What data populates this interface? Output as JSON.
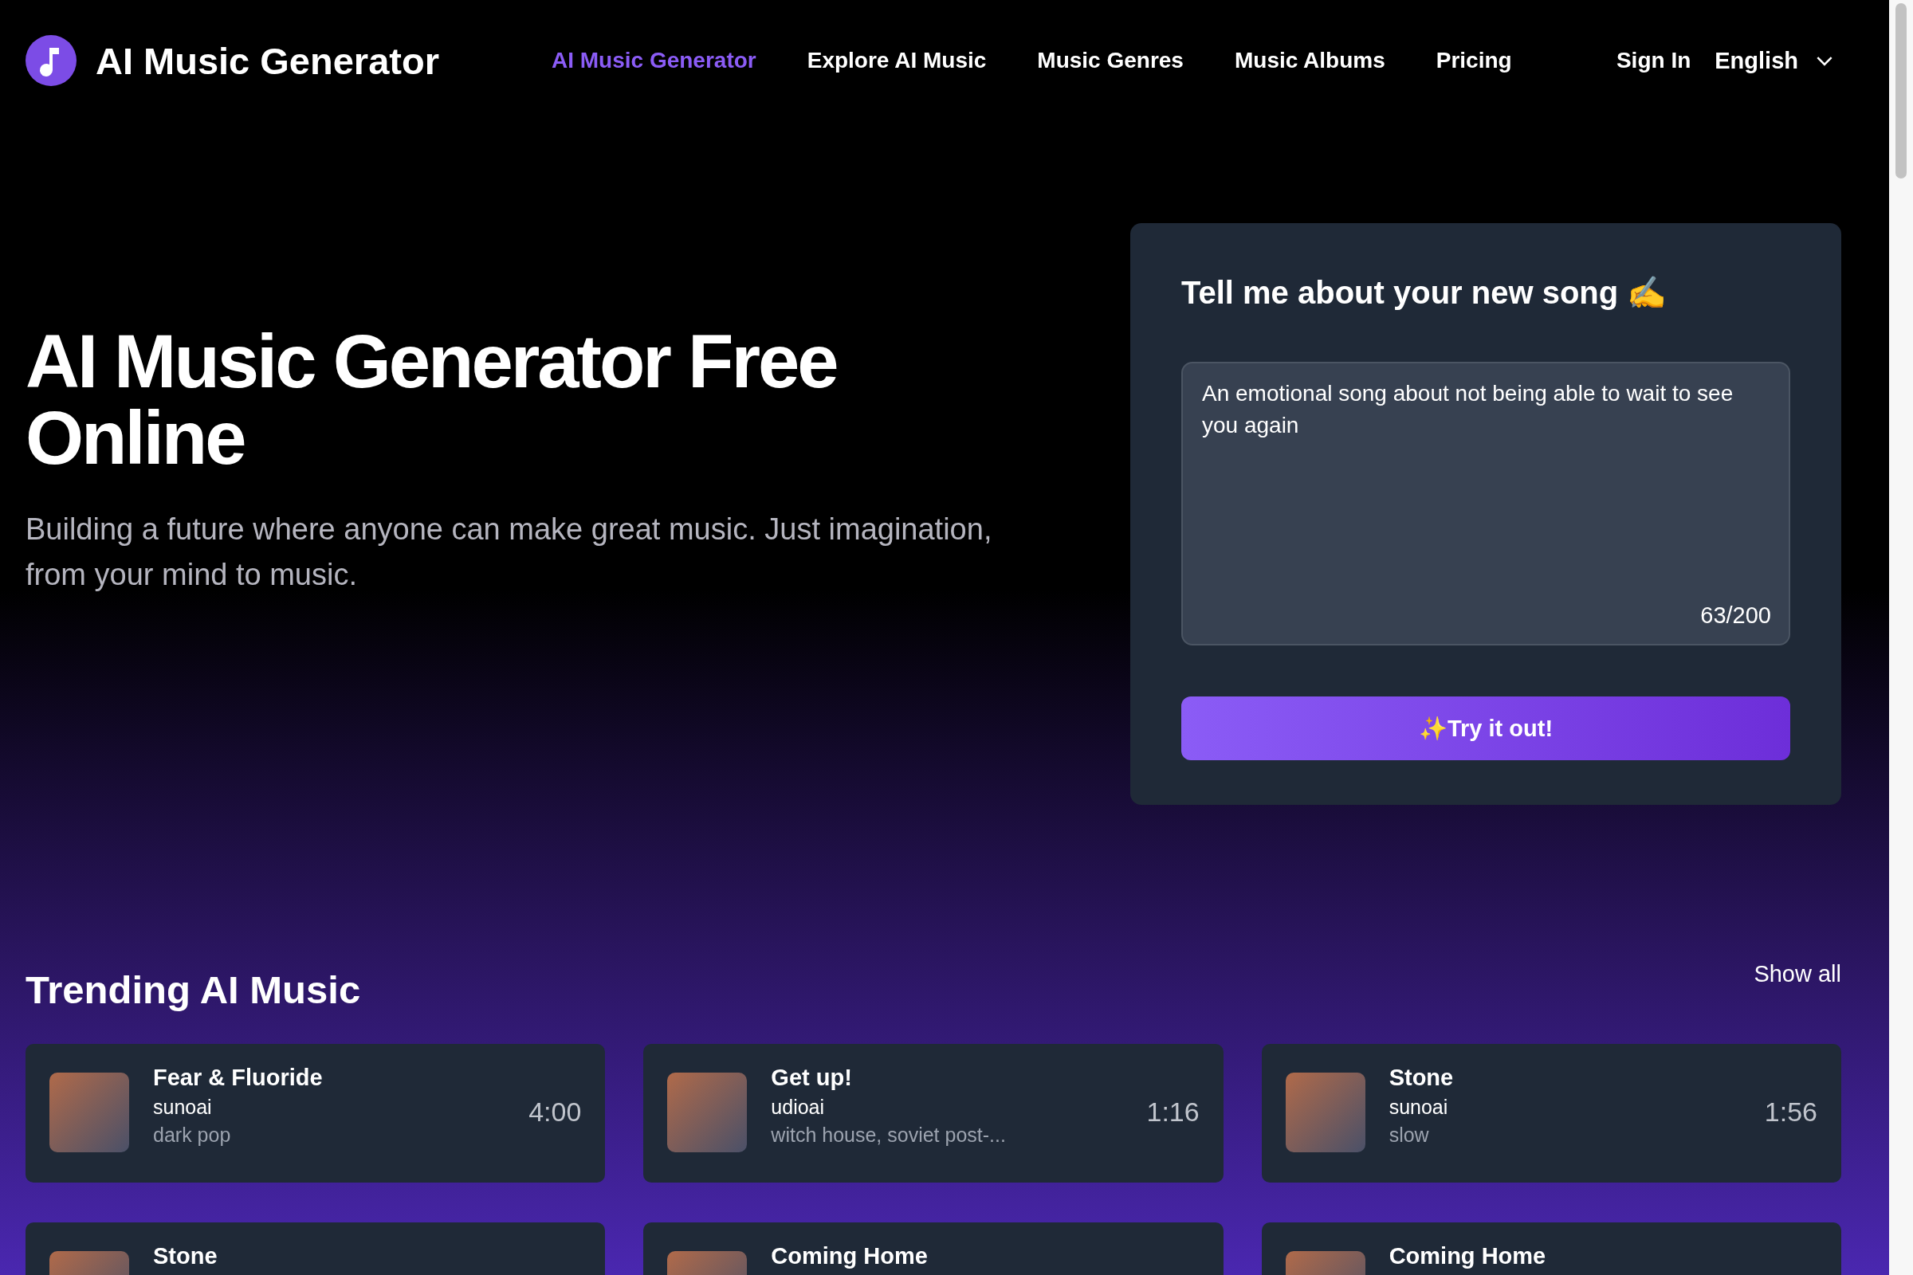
{
  "header": {
    "logo_text": "AI Music Generator",
    "nav": [
      {
        "label": "AI Music Generator",
        "selected": true
      },
      {
        "label": "Explore AI Music",
        "selected": false
      },
      {
        "label": "Music Genres",
        "selected": false
      },
      {
        "label": "Music Albums",
        "selected": false
      },
      {
        "label": "Pricing",
        "selected": false
      }
    ],
    "sign_in": "Sign In",
    "language": "English"
  },
  "hero": {
    "title": "AI Music Generator Free Online",
    "subtitle": "Building a future where anyone can make great music. Just imagination, from your mind to music."
  },
  "prompt_panel": {
    "title": "Tell me about your new song ✍️",
    "value": "An emotional song about not being able to wait to see you again",
    "counter": "63/200",
    "button": "✨Try it out!"
  },
  "trending": {
    "title": "Trending AI Music",
    "show_all": "Show all",
    "tracks": [
      {
        "title": "Fear & Fluoride",
        "artist": "sunoai",
        "tags": "dark pop",
        "duration": "4:00"
      },
      {
        "title": "Get up!",
        "artist": "udioai",
        "tags": "witch house, soviet post-...",
        "duration": "1:16"
      },
      {
        "title": "Stone",
        "artist": "sunoai",
        "tags": "slow",
        "duration": "1:56"
      },
      {
        "title": "Stone"
      },
      {
        "title": "Coming Home"
      },
      {
        "title": "Coming Home"
      }
    ]
  }
}
